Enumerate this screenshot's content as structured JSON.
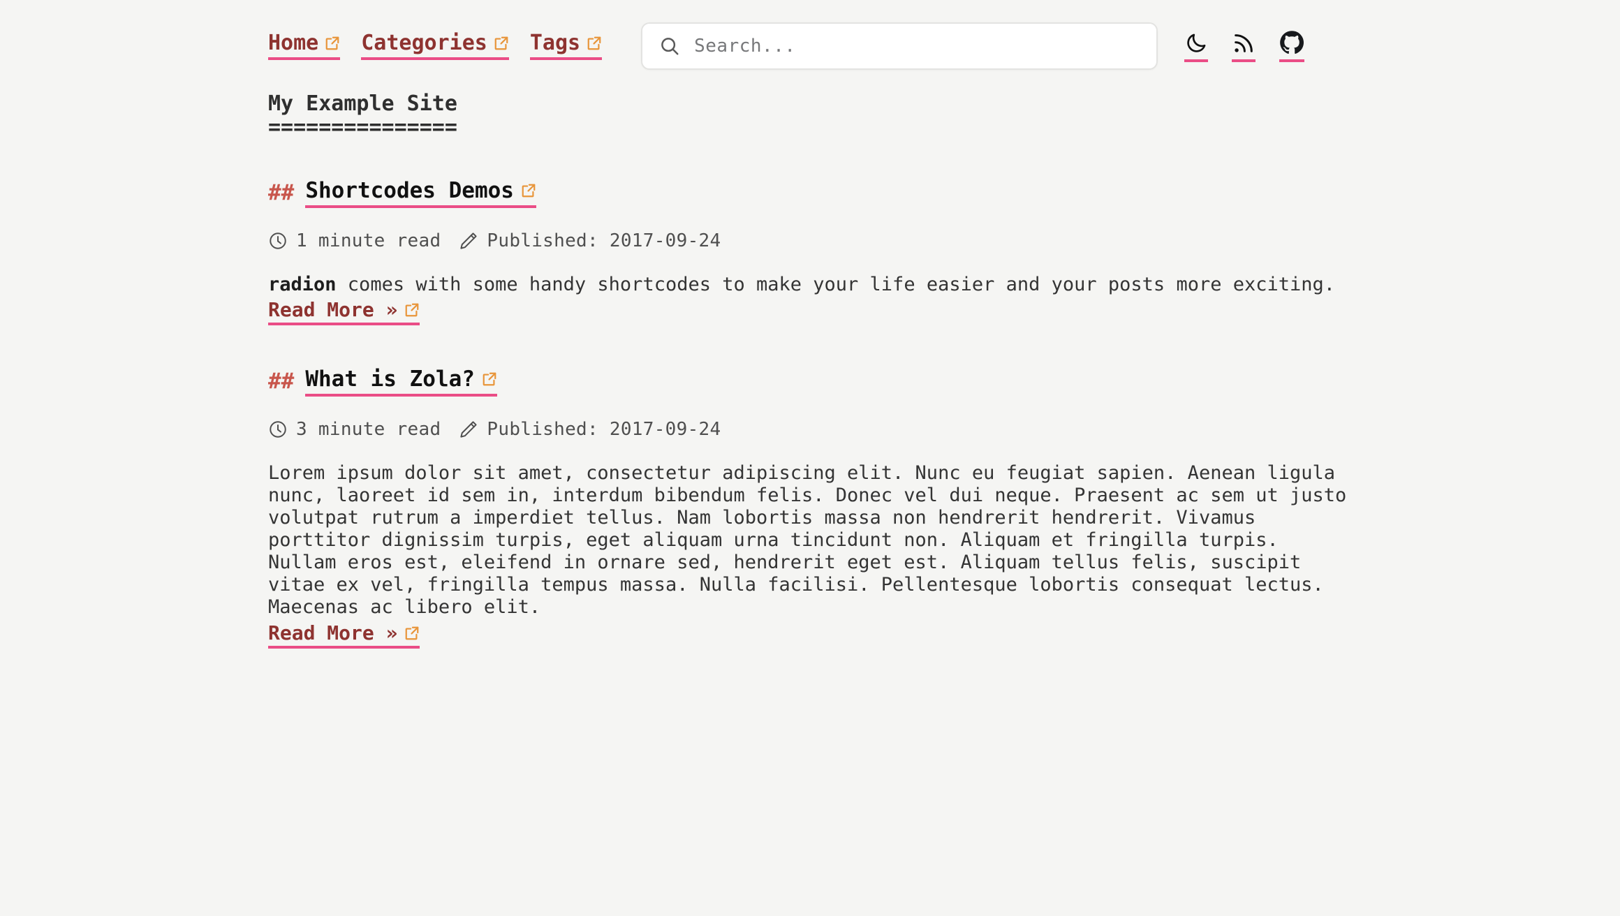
{
  "header": {
    "nav": [
      {
        "label": "Home",
        "icon": "external-link-icon"
      },
      {
        "label": "Categories",
        "icon": "external-link-icon"
      },
      {
        "label": "Tags",
        "icon": "external-link-icon"
      }
    ],
    "search": {
      "icon": "search-icon",
      "placeholder": "Search...",
      "value": ""
    },
    "tools": [
      {
        "name": "dark-mode-toggle",
        "icon": "moon-icon"
      },
      {
        "name": "rss-feed-link",
        "icon": "rss-icon"
      },
      {
        "name": "github-link",
        "icon": "github-icon"
      }
    ]
  },
  "site": {
    "title": "My Example Site",
    "rule": "==============="
  },
  "posts": [
    {
      "hash": "##",
      "title": "Shortcodes Demos",
      "title_icon": "external-link-icon",
      "read_icon": "clock-icon",
      "read_time": "1 minute read",
      "published_icon": "pencil-icon",
      "published": "Published: 2017-09-24",
      "excerpt_bold": "radion",
      "excerpt_rest": " comes with some handy shortcodes to make your life easier and your posts more exciting.",
      "read_more": "Read More »",
      "read_more_icon": "external-link-icon"
    },
    {
      "hash": "##",
      "title": "What is Zola?",
      "title_icon": "external-link-icon",
      "read_icon": "clock-icon",
      "read_time": "3 minute read",
      "published_icon": "pencil-icon",
      "published": "Published: 2017-09-24",
      "excerpt_bold": "",
      "excerpt_rest": "Lorem ipsum dolor sit amet, consectetur adipiscing elit. Nunc eu feugiat sapien. Aenean ligula nunc, laoreet id sem in, interdum bibendum felis. Donec vel dui neque. Praesent ac sem ut justo volutpat rutrum a imperdiet tellus. Nam lobortis massa non hendrerit hendrerit. Vivamus porttitor dignissim turpis, eget aliquam urna tincidunt non. Aliquam et fringilla turpis. Nullam eros est, eleifend in ornare sed, hendrerit eget est. Aliquam tellus felis, suscipit vitae ex vel, fringilla tempus massa. Nulla facilisi. Pellentesque lobortis consequat lectus. Maecenas ac libero elit.",
      "read_more": "Read More »",
      "read_more_icon": "external-link-icon"
    }
  ],
  "colors": {
    "background": "#f5f5f3",
    "link": "#8e3330",
    "underline": "#ea4d86",
    "external_icon": "#e8953a",
    "hash": "#c8564c",
    "title": "#111111",
    "body": "#343434"
  }
}
